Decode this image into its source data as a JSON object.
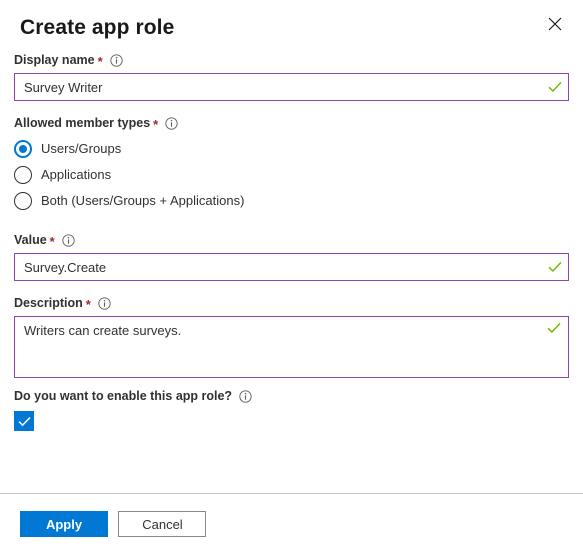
{
  "panel": {
    "title": "Create app role",
    "close_icon": "close-icon"
  },
  "fields": {
    "display_name": {
      "label": "Display name",
      "required_marker": "*",
      "info_icon": "info-icon",
      "value": "Survey Writer",
      "placeholder": "",
      "validation": "valid"
    },
    "allowed_member_types": {
      "label": "Allowed member types",
      "required_marker": "*",
      "info_icon": "info-icon",
      "selected": "Users/Groups",
      "options": [
        "Users/Groups",
        "Applications",
        "Both (Users/Groups + Applications)"
      ]
    },
    "value": {
      "label": "Value",
      "required_marker": "*",
      "info_icon": "info-icon",
      "value": "Survey.Create",
      "placeholder": "",
      "validation": "valid"
    },
    "description": {
      "label": "Description",
      "required_marker": "*",
      "info_icon": "info-icon",
      "value": "Writers can create surveys.",
      "placeholder": "",
      "validation": "valid"
    },
    "enable_role": {
      "label": "Do you want to enable this app role?",
      "info_icon": "info-icon",
      "checked": true
    }
  },
  "footer": {
    "apply_label": "Apply",
    "cancel_label": "Cancel"
  },
  "colors": {
    "accent": "#0078d4",
    "field_border": "#8e44ad",
    "required_star": "#a4262c",
    "valid_check": "#6bb700",
    "divider": "#c8c6c4",
    "text": "#323130"
  }
}
